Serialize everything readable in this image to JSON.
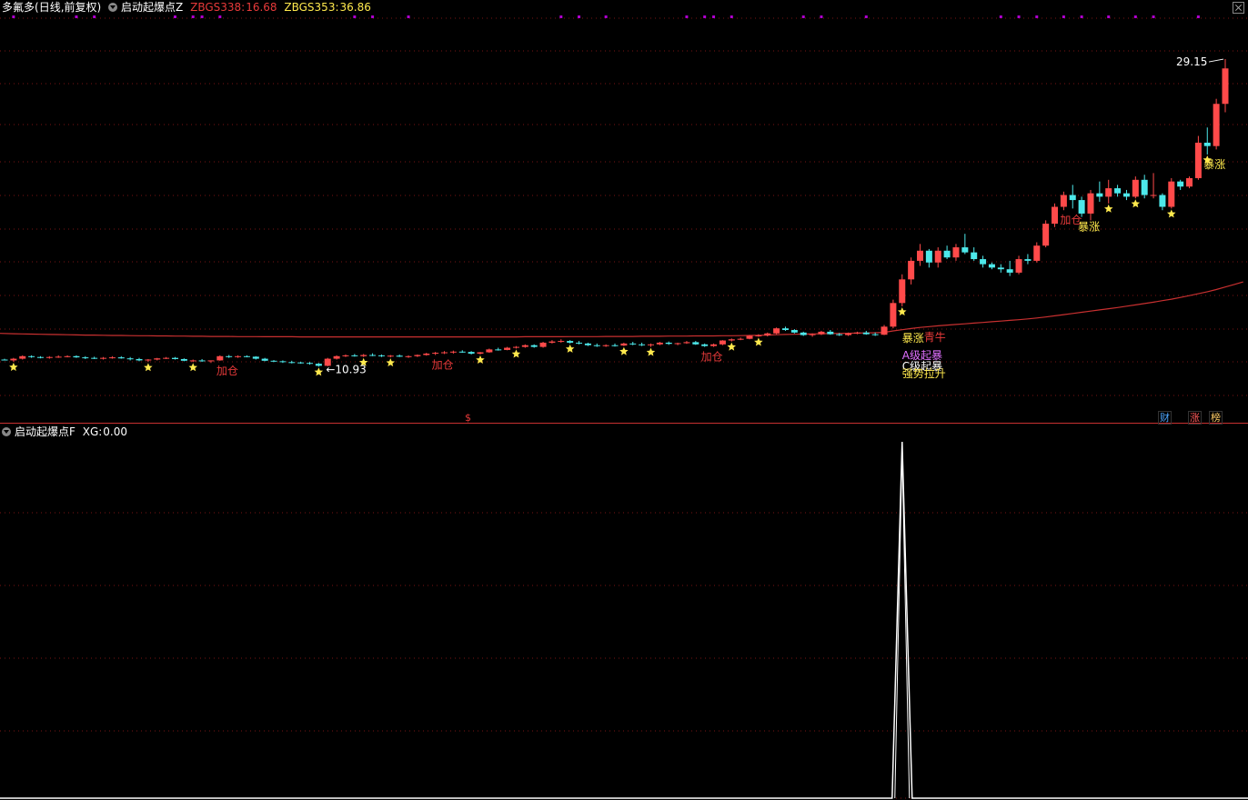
{
  "header": {
    "stock_name": "多氟多",
    "period": "(日线,前复权)",
    "indicator_main": "启动起爆点Z",
    "zbgs338_label": "ZBGS338:",
    "zbgs338_value": "16.68",
    "zbgs353_label": "ZBGS353:",
    "zbgs353_value": "36.86"
  },
  "sub_header": {
    "indicator": "启动起爆点F",
    "xg_label": "XG:",
    "xg_value": "0.00"
  },
  "badges": {
    "cai": "财",
    "zhang": "涨",
    "bang": "榜",
    "dollar": "$"
  },
  "colors": {
    "up": "#ff4a4a",
    "down": "#4de8ea",
    "ma": "#c83030",
    "grid": "#7a1414",
    "star": "#ffe94d",
    "buy_label": "#e83a3a",
    "surge_label": "#ffe94d",
    "a_level": "#e070ff",
    "c_level": "#ffffff",
    "strong": "#ffe94d",
    "xg_line": "#ffffff",
    "event_dot": "#b000d0",
    "zbgs338": "#e83a3a",
    "zbgs353": "#ffe94d"
  },
  "chart_data": [
    {
      "type": "candlestick",
      "title": "多氟多 (日线,前复权)",
      "y_range_estimate": [
        9.6,
        30.5
      ],
      "price_labels": {
        "high": "29.15",
        "low": "10.93"
      },
      "candles": [
        [
          11.35,
          11.4,
          11.3,
          11.3
        ],
        [
          11.3,
          11.45,
          11.22,
          11.4
        ],
        [
          11.4,
          11.6,
          11.35,
          11.55
        ],
        [
          11.55,
          11.6,
          11.45,
          11.5
        ],
        [
          11.5,
          11.55,
          11.42,
          11.45
        ],
        [
          11.45,
          11.55,
          11.4,
          11.5
        ],
        [
          11.5,
          11.6,
          11.45,
          11.52
        ],
        [
          11.52,
          11.6,
          11.48,
          11.55
        ],
        [
          11.55,
          11.6,
          11.45,
          11.48
        ],
        [
          11.48,
          11.55,
          11.38,
          11.45
        ],
        [
          11.45,
          11.52,
          11.38,
          11.42
        ],
        [
          11.42,
          11.5,
          11.35,
          11.45
        ],
        [
          11.45,
          11.55,
          11.4,
          11.48
        ],
        [
          11.48,
          11.55,
          11.4,
          11.42
        ],
        [
          11.42,
          11.5,
          11.3,
          11.38
        ],
        [
          11.38,
          11.45,
          11.25,
          11.3
        ],
        [
          11.3,
          11.38,
          11.2,
          11.35
        ],
        [
          11.35,
          11.45,
          11.3,
          11.42
        ],
        [
          11.42,
          11.5,
          11.38,
          11.45
        ],
        [
          11.45,
          11.5,
          11.35,
          11.38
        ],
        [
          11.38,
          11.42,
          11.25,
          11.28
        ],
        [
          11.28,
          11.35,
          11.2,
          11.3
        ],
        [
          11.3,
          11.38,
          11.22,
          11.25
        ],
        [
          11.25,
          11.3,
          11.15,
          11.3
        ],
        [
          11.3,
          11.6,
          11.28,
          11.55
        ],
        [
          11.55,
          11.62,
          11.45,
          11.5
        ],
        [
          11.5,
          11.6,
          11.45,
          11.55
        ],
        [
          11.55,
          11.6,
          11.48,
          11.52
        ],
        [
          11.52,
          11.55,
          11.35,
          11.4
        ],
        [
          11.4,
          11.45,
          11.25,
          11.28
        ],
        [
          11.28,
          11.32,
          11.2,
          11.25
        ],
        [
          11.25,
          11.3,
          11.15,
          11.2
        ],
        [
          11.2,
          11.28,
          11.12,
          11.18
        ],
        [
          11.18,
          11.22,
          11.1,
          11.15
        ],
        [
          11.15,
          11.2,
          11.05,
          11.1
        ],
        [
          11.1,
          11.15,
          10.93,
          10.98
        ],
        [
          10.98,
          11.45,
          10.95,
          11.4
        ],
        [
          11.4,
          11.6,
          11.35,
          11.55
        ],
        [
          11.55,
          11.65,
          11.5,
          11.6
        ],
        [
          11.6,
          11.68,
          11.52,
          11.55
        ],
        [
          11.55,
          11.68,
          11.5,
          11.62
        ],
        [
          11.62,
          11.72,
          11.55,
          11.6
        ],
        [
          11.6,
          11.65,
          11.5,
          11.55
        ],
        [
          11.55,
          11.62,
          11.48,
          11.58
        ],
        [
          11.58,
          11.65,
          11.5,
          11.52
        ],
        [
          11.52,
          11.6,
          11.45,
          11.55
        ],
        [
          11.55,
          11.65,
          11.5,
          11.62
        ],
        [
          11.62,
          11.75,
          11.58,
          11.7
        ],
        [
          11.7,
          11.8,
          11.62,
          11.75
        ],
        [
          11.75,
          11.85,
          11.68,
          11.78
        ],
        [
          11.78,
          11.88,
          11.7,
          11.82
        ],
        [
          11.82,
          11.9,
          11.75,
          11.8
        ],
        [
          11.8,
          11.85,
          11.65,
          11.7
        ],
        [
          11.7,
          11.8,
          11.65,
          11.78
        ],
        [
          11.78,
          12.0,
          11.75,
          11.95
        ],
        [
          11.95,
          12.05,
          11.88,
          11.92
        ],
        [
          11.92,
          12.1,
          11.9,
          12.05
        ],
        [
          12.05,
          12.15,
          12.0,
          12.1
        ],
        [
          12.1,
          12.25,
          12.05,
          12.2
        ],
        [
          12.2,
          12.25,
          12.05,
          12.1
        ],
        [
          12.1,
          12.4,
          12.05,
          12.35
        ],
        [
          12.35,
          12.5,
          12.3,
          12.42
        ],
        [
          12.42,
          12.55,
          12.35,
          12.45
        ],
        [
          12.45,
          12.5,
          12.3,
          12.35
        ],
        [
          12.35,
          12.45,
          12.25,
          12.3
        ],
        [
          12.3,
          12.35,
          12.15,
          12.2
        ],
        [
          12.2,
          12.3,
          12.1,
          12.15
        ],
        [
          12.15,
          12.25,
          12.1,
          12.2
        ],
        [
          12.2,
          12.3,
          12.12,
          12.18
        ],
        [
          12.18,
          12.35,
          12.15,
          12.3
        ],
        [
          12.3,
          12.4,
          12.2,
          12.25
        ],
        [
          12.25,
          12.35,
          12.15,
          12.2
        ],
        [
          12.2,
          12.3,
          12.1,
          12.25
        ],
        [
          12.25,
          12.4,
          12.2,
          12.35
        ],
        [
          12.35,
          12.42,
          12.22,
          12.28
        ],
        [
          12.28,
          12.35,
          12.2,
          12.32
        ],
        [
          12.32,
          12.45,
          12.28,
          12.38
        ],
        [
          12.38,
          12.45,
          12.22,
          12.25
        ],
        [
          12.25,
          12.3,
          12.1,
          12.15
        ],
        [
          12.15,
          12.3,
          12.1,
          12.25
        ],
        [
          12.25,
          12.5,
          12.2,
          12.48
        ],
        [
          12.48,
          12.6,
          12.42,
          12.55
        ],
        [
          12.55,
          12.65,
          12.5,
          12.58
        ],
        [
          12.58,
          12.8,
          12.55,
          12.75
        ],
        [
          12.75,
          12.85,
          12.7,
          12.78
        ],
        [
          12.78,
          12.95,
          12.72,
          12.9
        ],
        [
          12.9,
          13.25,
          12.85,
          13.2
        ],
        [
          13.2,
          13.3,
          13.05,
          13.1
        ],
        [
          13.1,
          13.15,
          12.9,
          12.95
        ],
        [
          12.95,
          13.0,
          12.75,
          12.8
        ],
        [
          12.8,
          12.9,
          12.7,
          12.85
        ],
        [
          12.85,
          13.05,
          12.8,
          13.0
        ],
        [
          13.0,
          13.1,
          12.82,
          12.85
        ],
        [
          12.85,
          12.92,
          12.75,
          12.8
        ],
        [
          12.8,
          12.95,
          12.75,
          12.9
        ],
        [
          12.9,
          13.0,
          12.85,
          12.95
        ],
        [
          12.95,
          13.05,
          12.82,
          12.85
        ],
        [
          12.85,
          12.95,
          12.75,
          12.82
        ],
        [
          12.82,
          13.4,
          12.8,
          13.3
        ],
        [
          13.3,
          14.9,
          13.2,
          14.7
        ],
        [
          14.7,
          16.4,
          14.5,
          16.1
        ],
        [
          16.1,
          17.4,
          15.8,
          17.2
        ],
        [
          17.2,
          18.2,
          16.9,
          17.8
        ],
        [
          17.8,
          17.9,
          16.8,
          17.1
        ],
        [
          17.1,
          18.0,
          16.8,
          17.8
        ],
        [
          17.8,
          18.1,
          17.3,
          17.4
        ],
        [
          17.4,
          18.2,
          17.2,
          18.0
        ],
        [
          18.0,
          18.8,
          17.6,
          17.7
        ],
        [
          17.7,
          18.0,
          17.2,
          17.3
        ],
        [
          17.3,
          17.5,
          16.8,
          17.0
        ],
        [
          17.0,
          17.1,
          16.7,
          16.8
        ],
        [
          16.8,
          17.0,
          16.5,
          16.7
        ],
        [
          16.7,
          17.2,
          16.3,
          16.5
        ],
        [
          16.5,
          17.5,
          16.4,
          17.3
        ],
        [
          17.3,
          17.6,
          17.0,
          17.2
        ],
        [
          17.2,
          18.3,
          17.1,
          18.1
        ],
        [
          18.1,
          19.6,
          18.0,
          19.4
        ],
        [
          19.4,
          20.6,
          19.2,
          20.4
        ],
        [
          20.4,
          21.3,
          20.2,
          21.1
        ],
        [
          21.1,
          21.7,
          20.3,
          20.8
        ],
        [
          20.8,
          21.0,
          19.8,
          20.0
        ],
        [
          20.0,
          21.4,
          19.6,
          21.2
        ],
        [
          21.2,
          21.9,
          20.7,
          21.0
        ],
        [
          21.0,
          22.0,
          20.6,
          21.5
        ],
        [
          21.5,
          21.7,
          21.0,
          21.2
        ],
        [
          21.2,
          21.4,
          20.8,
          21.0
        ],
        [
          21.0,
          22.2,
          20.9,
          22.0
        ],
        [
          22.0,
          22.3,
          20.9,
          21.1
        ],
        [
          21.1,
          22.4,
          20.9,
          21.1
        ],
        [
          21.1,
          21.2,
          20.2,
          20.4
        ],
        [
          20.4,
          22.1,
          20.3,
          21.9
        ],
        [
          21.9,
          22.0,
          21.4,
          21.6
        ],
        [
          21.6,
          22.2,
          21.5,
          22.1
        ],
        [
          22.1,
          24.6,
          22.0,
          24.2
        ],
        [
          24.2,
          25.1,
          23.5,
          24.0
        ],
        [
          24.0,
          26.8,
          23.8,
          26.5
        ],
        [
          26.5,
          29.15,
          26.0,
          28.6
        ]
      ],
      "ma_line": [
        12.9,
        12.88,
        12.87,
        12.86,
        12.85,
        12.84,
        12.83,
        12.82,
        12.81,
        12.8,
        12.8,
        12.79,
        12.78,
        12.78,
        12.77,
        12.76,
        12.76,
        12.75,
        12.75,
        12.74,
        12.74,
        12.73,
        12.73,
        12.72,
        12.72,
        12.72,
        12.71,
        12.71,
        12.71,
        12.7,
        12.7,
        12.7,
        12.7,
        12.69,
        12.69,
        12.69,
        12.69,
        12.69,
        12.69,
        12.69,
        12.69,
        12.69,
        12.69,
        12.69,
        12.69,
        12.69,
        12.69,
        12.69,
        12.69,
        12.69,
        12.69,
        12.69,
        12.69,
        12.69,
        12.69,
        12.69,
        12.69,
        12.69,
        12.7,
        12.7,
        12.7,
        12.7,
        12.7,
        12.71,
        12.71,
        12.71,
        12.71,
        12.72,
        12.72,
        12.72,
        12.72,
        12.73,
        12.73,
        12.73,
        12.74,
        12.74,
        12.74,
        12.75,
        12.75,
        12.75,
        12.76,
        12.76,
        12.77,
        12.78,
        12.79,
        12.8,
        12.82,
        12.84,
        12.85,
        12.86,
        12.87,
        12.88,
        12.89,
        12.9,
        12.91,
        12.92,
        12.93,
        12.94,
        12.96,
        13.05,
        13.12,
        13.19,
        13.25,
        13.3,
        13.35,
        13.39,
        13.43,
        13.47,
        13.51,
        13.55,
        13.59,
        13.63,
        13.67,
        13.71,
        13.76,
        13.81,
        13.87,
        13.94,
        14.01,
        14.08,
        14.15,
        14.22,
        14.29,
        14.36,
        14.43,
        14.51,
        14.59,
        14.67,
        14.75,
        14.84,
        14.93,
        15.03,
        15.14,
        15.25,
        15.37,
        15.5,
        15.65,
        15.8,
        15.95
      ],
      "stars": [
        1,
        16,
        21,
        35,
        40,
        43,
        53,
        57,
        63,
        69,
        72,
        81,
        84,
        100,
        123,
        126,
        130,
        134
      ],
      "annotations": [
        {
          "i": 24,
          "text": "加仓",
          "kind": "buy"
        },
        {
          "i": 48,
          "text": "加仓",
          "kind": "buy"
        },
        {
          "i": 78,
          "text": "加仓",
          "kind": "buy"
        },
        {
          "i": 118,
          "text": "加仓",
          "kind": "buy"
        },
        {
          "i": 100,
          "text": "暴涨",
          "kind": "surge"
        },
        {
          "i": 100,
          "text": "青牛",
          "kind": "buy"
        },
        {
          "i": 120,
          "text": "暴涨",
          "kind": "surge"
        },
        {
          "i": 134,
          "text": "暴涨",
          "kind": "surge"
        },
        {
          "i": 100,
          "text": "A级起暴",
          "kind": "a_level"
        },
        {
          "i": 100,
          "text": "C级起暴",
          "kind": "c_level"
        },
        {
          "i": 100,
          "text": "强势拉升",
          "kind": "strong"
        }
      ],
      "event_markers": [
        1,
        8,
        10,
        19,
        21,
        22,
        24,
        39,
        41,
        45,
        62,
        64,
        67,
        76,
        78,
        79,
        81,
        89,
        91,
        96,
        111,
        113,
        115,
        118,
        120,
        123,
        126,
        128,
        133
      ]
    },
    {
      "type": "line",
      "title": "启动起爆点F",
      "series": [
        {
          "name": "XG",
          "spike_index": 100,
          "spike_value": 1,
          "baseline": 0
        }
      ]
    }
  ]
}
